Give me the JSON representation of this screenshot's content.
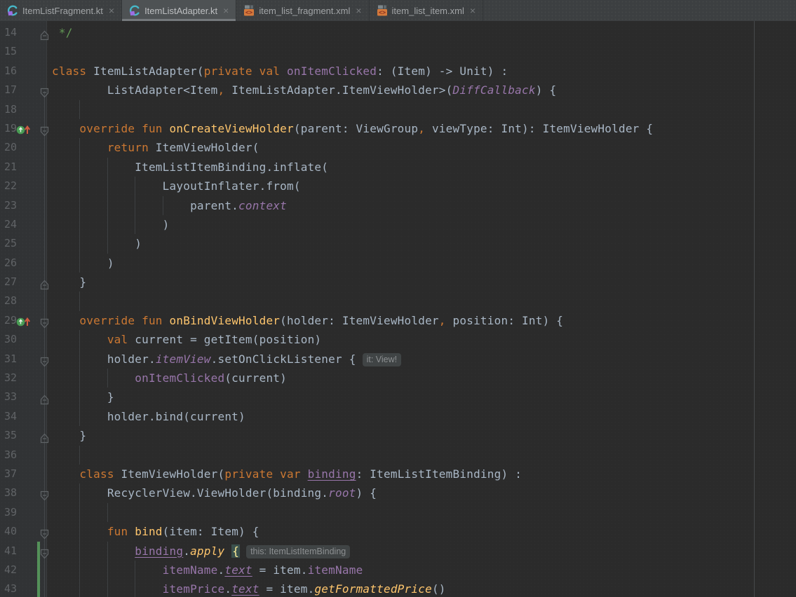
{
  "tab_bar": {
    "tabs": [
      {
        "label": "ItemListFragment.kt",
        "icon": "kotlin-file-icon",
        "active": false,
        "close_label": "×"
      },
      {
        "label": "ItemListAdapter.kt",
        "icon": "kotlin-file-icon",
        "active": true,
        "close_label": "×"
      },
      {
        "label": "item_list_fragment.xml",
        "icon": "xml-file-icon",
        "active": false,
        "close_label": "×"
      },
      {
        "label": "item_list_item.xml",
        "icon": "xml-file-icon",
        "active": false,
        "close_label": "×"
      }
    ]
  },
  "colors": {
    "editor_background": "#2B2B2B",
    "gutter_background": "#313335",
    "tabbar_background": "#3C3F41",
    "active_tab_background": "#4E5254",
    "keyword": "#CC7832",
    "default_text": "#A9B7C6",
    "function_declaration": "#FFC66D",
    "property": "#9876AA",
    "comment": "#629755",
    "line_number": "#606366",
    "vcs_added_bar": "#549159",
    "brace_match_background": "#3B514D"
  },
  "editor": {
    "lines": [
      {
        "n": "14",
        "ind": 1,
        "fold": "up",
        "g": [],
        "segs": [
          {
            "t": "*/",
            "c": "cmt"
          }
        ]
      },
      {
        "n": "15",
        "ind": 0,
        "g": [],
        "segs": []
      },
      {
        "n": "16",
        "ind": 0,
        "g": [],
        "segs": [
          {
            "t": "class",
            "c": "kw"
          },
          {
            "t": " ItemListAdapter(",
            "c": "def"
          },
          {
            "t": "private val",
            "c": "kw"
          },
          {
            "t": " ",
            "c": "def"
          },
          {
            "t": "onItemClicked",
            "c": "prop"
          },
          {
            "t": ": (Item) -> Unit) :",
            "c": "def"
          }
        ]
      },
      {
        "n": "17",
        "ind": 8,
        "fold": "down",
        "g": [],
        "segs": [
          {
            "t": "ListAdapter<Item",
            "c": "def"
          },
          {
            "t": ",",
            "c": "kw"
          },
          {
            "t": " ItemListAdapter.ItemViewHolder>(",
            "c": "def"
          },
          {
            "t": "DiffCallback",
            "c": "propi"
          },
          {
            "t": ") {",
            "c": "def"
          }
        ]
      },
      {
        "n": "18",
        "ind": 0,
        "g": [
          4
        ],
        "segs": []
      },
      {
        "n": "19",
        "ind": 4,
        "fold": "down",
        "ovr": true,
        "g": [],
        "segs": [
          {
            "t": "override fun",
            "c": "kw"
          },
          {
            "t": " ",
            "c": "def"
          },
          {
            "t": "onCreateViewHolder",
            "c": "fn"
          },
          {
            "t": "(parent: ViewGroup",
            "c": "def"
          },
          {
            "t": ",",
            "c": "kw"
          },
          {
            "t": " viewType: Int): ItemViewHolder {",
            "c": "def"
          }
        ]
      },
      {
        "n": "20",
        "ind": 8,
        "g": [
          4
        ],
        "segs": [
          {
            "t": "return",
            "c": "kw"
          },
          {
            "t": " ItemViewHolder(",
            "c": "def"
          }
        ]
      },
      {
        "n": "21",
        "ind": 12,
        "g": [
          4,
          8
        ],
        "segs": [
          {
            "t": "ItemListItemBinding.inflate(",
            "c": "def"
          }
        ]
      },
      {
        "n": "22",
        "ind": 16,
        "g": [
          4,
          8,
          12
        ],
        "segs": [
          {
            "t": "LayoutInflater.from(",
            "c": "def"
          }
        ]
      },
      {
        "n": "23",
        "ind": 20,
        "g": [
          4,
          8,
          12,
          16
        ],
        "segs": [
          {
            "t": "parent.",
            "c": "def"
          },
          {
            "t": "context",
            "c": "propi"
          }
        ]
      },
      {
        "n": "24",
        "ind": 16,
        "g": [
          4,
          8,
          12
        ],
        "segs": [
          {
            "t": ")",
            "c": "def"
          }
        ]
      },
      {
        "n": "25",
        "ind": 12,
        "g": [
          4,
          8
        ],
        "segs": [
          {
            "t": ")",
            "c": "def"
          }
        ]
      },
      {
        "n": "26",
        "ind": 8,
        "g": [
          4
        ],
        "segs": [
          {
            "t": ")",
            "c": "def"
          }
        ]
      },
      {
        "n": "27",
        "ind": 4,
        "fold": "up",
        "g": [],
        "segs": [
          {
            "t": "}",
            "c": "def"
          }
        ]
      },
      {
        "n": "28",
        "ind": 0,
        "g": [
          4
        ],
        "segs": []
      },
      {
        "n": "29",
        "ind": 4,
        "fold": "down",
        "ovr": true,
        "g": [],
        "segs": [
          {
            "t": "override fun",
            "c": "kw"
          },
          {
            "t": " ",
            "c": "def"
          },
          {
            "t": "onBindViewHolder",
            "c": "fn"
          },
          {
            "t": "(holder: ItemViewHolder",
            "c": "def"
          },
          {
            "t": ",",
            "c": "kw"
          },
          {
            "t": " position: Int) {",
            "c": "def"
          }
        ]
      },
      {
        "n": "30",
        "ind": 8,
        "g": [
          4
        ],
        "segs": [
          {
            "t": "val",
            "c": "kw"
          },
          {
            "t": " current = getItem(position)",
            "c": "def"
          }
        ]
      },
      {
        "n": "31",
        "ind": 8,
        "fold": "down",
        "g": [
          4
        ],
        "segs": [
          {
            "t": "holder.",
            "c": "def"
          },
          {
            "t": "itemView",
            "c": "propi"
          },
          {
            "t": ".setOnClickListener ",
            "c": "def"
          },
          {
            "t": "{",
            "c": "def"
          },
          {
            "t": "it: View!",
            "c": "hint"
          }
        ]
      },
      {
        "n": "32",
        "ind": 12,
        "g": [
          4,
          8
        ],
        "segs": [
          {
            "t": "onItemClicked",
            "c": "prop"
          },
          {
            "t": "(current)",
            "c": "def"
          }
        ]
      },
      {
        "n": "33",
        "ind": 8,
        "fold": "up",
        "g": [
          4
        ],
        "segs": [
          {
            "t": "}",
            "c": "def"
          }
        ]
      },
      {
        "n": "34",
        "ind": 8,
        "g": [
          4
        ],
        "segs": [
          {
            "t": "holder.bind(current)",
            "c": "def"
          }
        ]
      },
      {
        "n": "35",
        "ind": 4,
        "fold": "up",
        "g": [],
        "segs": [
          {
            "t": "}",
            "c": "def"
          }
        ]
      },
      {
        "n": "36",
        "ind": 0,
        "g": [
          4
        ],
        "segs": []
      },
      {
        "n": "37",
        "ind": 4,
        "g": [],
        "segs": [
          {
            "t": "class",
            "c": "kw"
          },
          {
            "t": " ItemViewHolder(",
            "c": "def"
          },
          {
            "t": "private var",
            "c": "kw"
          },
          {
            "t": " ",
            "c": "def"
          },
          {
            "t": "binding",
            "c": "propu"
          },
          {
            "t": ": ItemListItemBinding) :",
            "c": "def"
          }
        ]
      },
      {
        "n": "38",
        "ind": 8,
        "fold": "down",
        "g": [
          4
        ],
        "segs": [
          {
            "t": "RecyclerView.ViewHolder(binding.",
            "c": "def"
          },
          {
            "t": "root",
            "c": "propi"
          },
          {
            "t": ") {",
            "c": "def"
          }
        ]
      },
      {
        "n": "39",
        "ind": 0,
        "g": [
          4,
          8
        ],
        "segs": []
      },
      {
        "n": "40",
        "ind": 8,
        "fold": "down",
        "g": [
          4
        ],
        "segs": [
          {
            "t": "fun",
            "c": "kw"
          },
          {
            "t": " ",
            "c": "def"
          },
          {
            "t": "bind",
            "c": "fn"
          },
          {
            "t": "(item: Item) {",
            "c": "def"
          }
        ]
      },
      {
        "n": "41",
        "ind": 12,
        "fold": "down",
        "vcs": true,
        "g": [
          4,
          8
        ],
        "segs": [
          {
            "t": "binding",
            "c": "propu"
          },
          {
            "t": ".",
            "c": "def"
          },
          {
            "t": "apply",
            "c": "fni"
          },
          {
            "t": " ",
            "c": "def"
          },
          {
            "t": "{",
            "c": "hl"
          },
          {
            "t": "this: ItemListItemBinding",
            "c": "hint"
          }
        ]
      },
      {
        "n": "42",
        "ind": 16,
        "vcs": true,
        "g": [
          4,
          8,
          12
        ],
        "segs": [
          {
            "t": "itemName",
            "c": "prop"
          },
          {
            "t": ".",
            "c": "def"
          },
          {
            "t": "text",
            "c": "propiu"
          },
          {
            "t": " = item.",
            "c": "def"
          },
          {
            "t": "itemName",
            "c": "prop"
          }
        ]
      },
      {
        "n": "43",
        "ind": 16,
        "vcs": true,
        "g": [
          4,
          8,
          12
        ],
        "segs": [
          {
            "t": "itemPrice",
            "c": "prop"
          },
          {
            "t": ".",
            "c": "def"
          },
          {
            "t": "text",
            "c": "propiu"
          },
          {
            "t": " = item.",
            "c": "def"
          },
          {
            "t": "getFormattedPrice",
            "c": "fni"
          },
          {
            "t": "()",
            "c": "def"
          }
        ]
      }
    ]
  }
}
